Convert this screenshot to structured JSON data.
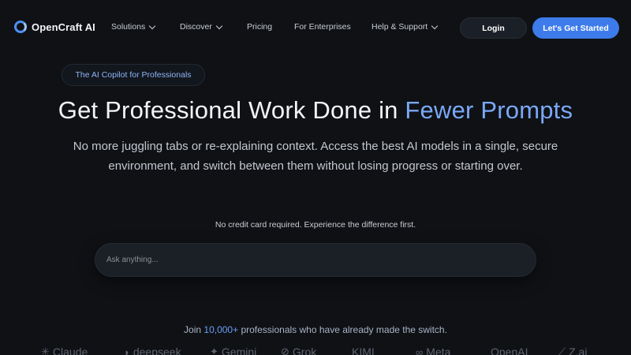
{
  "nav": {
    "brand": "OpenCraft AI",
    "links": [
      {
        "label": "Solutions",
        "dropdown": true
      },
      {
        "label": "Discover",
        "dropdown": true
      },
      {
        "label": "Pricing",
        "dropdown": false
      },
      {
        "label": "For Enterprises",
        "dropdown": false
      },
      {
        "label": "Help & Support",
        "dropdown": true
      }
    ],
    "login_label": "Login",
    "cta_label": "Let's Get Started"
  },
  "hero": {
    "badge": "The AI Copilot for Professionals",
    "title_main": "Get Professional Work Done in ",
    "title_accent": "Fewer Prompts",
    "subtitle": "No more juggling tabs or re-explaining context. Access the best AI models in a single, secure environment, and switch between them without losing progress or starting over.",
    "note": "No credit card required. Experience the difference first.",
    "prompt_placeholder": "Ask anything..."
  },
  "social": {
    "join_prefix": "Join ",
    "join_count": "10,000+",
    "join_suffix": " professionals who have already made the switch.",
    "brands": [
      "Claude",
      "deepseek",
      "Gemini",
      "Grok",
      "KIMI",
      "Meta",
      "OpenAI",
      "Z.ai"
    ]
  },
  "colors": {
    "background": "#0f1115",
    "accent": "#3d7bea",
    "accent_text": "#7aa8f7"
  }
}
